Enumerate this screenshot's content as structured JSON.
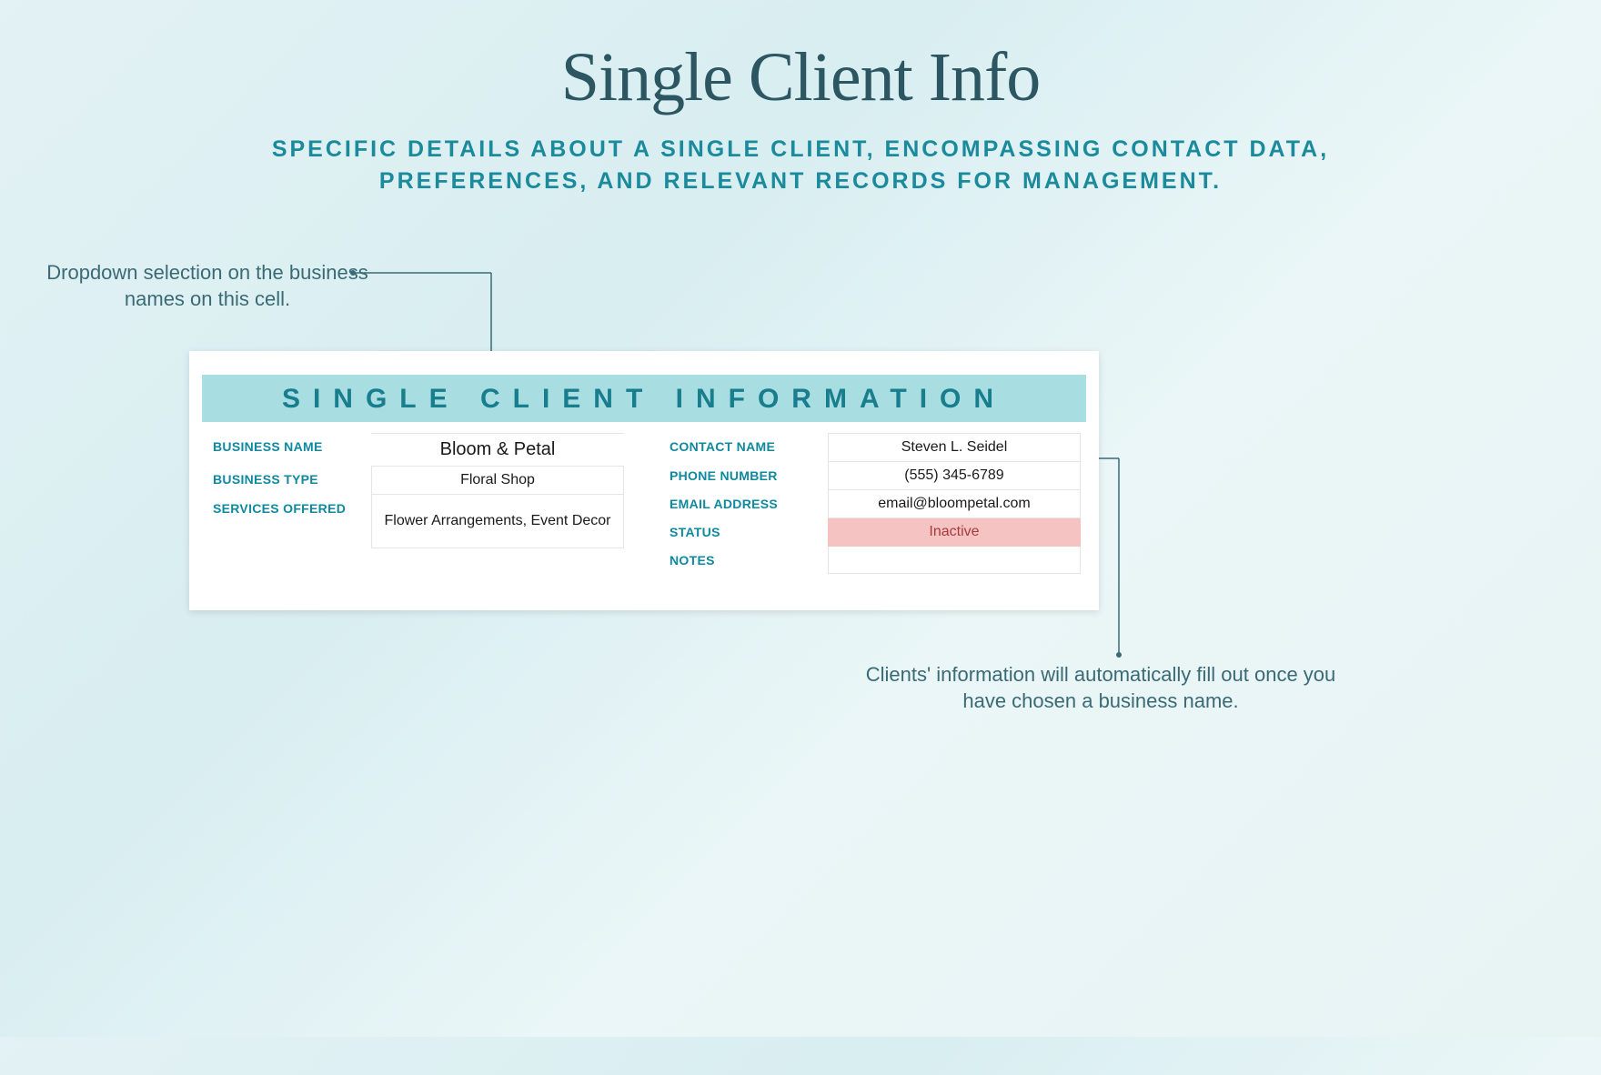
{
  "header": {
    "title": "Single Client Info",
    "subtitle": "SPECIFIC DETAILS ABOUT A SINGLE CLIENT, ENCOMPASSING CONTACT DATA, PREFERENCES, AND RELEVANT RECORDS FOR MANAGEMENT."
  },
  "annotations": {
    "top": "Dropdown selection on the business names on this cell.",
    "bottom": "Clients' information will automatically fill out once you have chosen a business name."
  },
  "card": {
    "banner": "SINGLE CLIENT INFORMATION",
    "left": {
      "business_name_label": "BUSINESS NAME",
      "business_name_value": "Bloom & Petal",
      "business_type_label": "BUSINESS TYPE",
      "business_type_value": "Floral Shop",
      "services_label": "SERVICES OFFERED",
      "services_value": "Flower Arrangements, Event Decor"
    },
    "right": {
      "contact_name_label": "CONTACT NAME",
      "contact_name_value": "Steven L. Seidel",
      "phone_label": "PHONE NUMBER",
      "phone_value": "(555) 345-6789",
      "email_label": "EMAIL ADDRESS",
      "email_value": "email@bloompetal.com",
      "status_label": "STATUS",
      "status_value": "Inactive",
      "notes_label": "NOTES",
      "notes_value": ""
    }
  }
}
